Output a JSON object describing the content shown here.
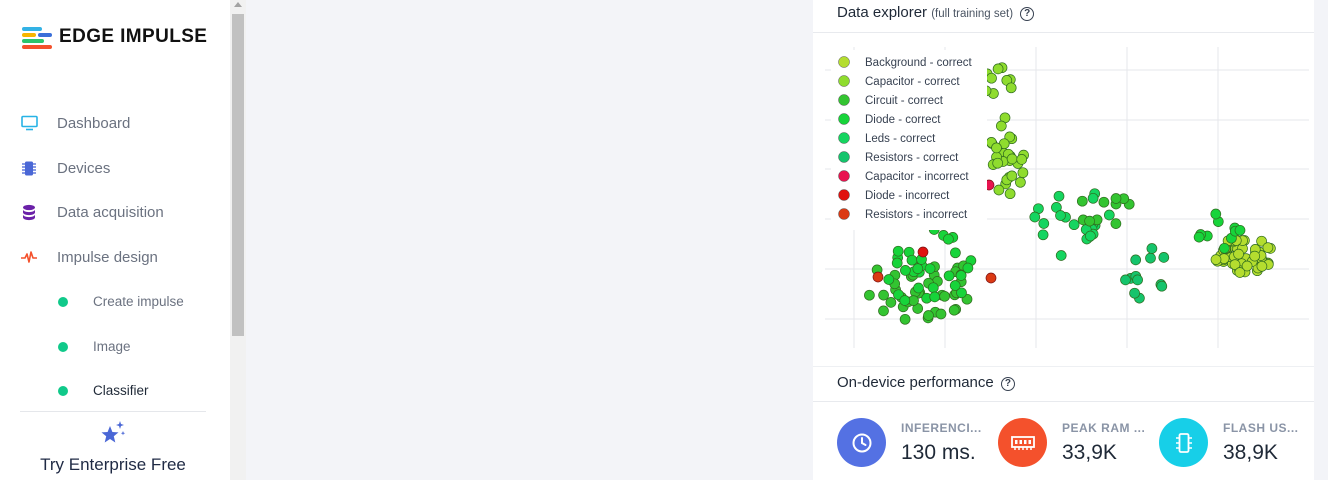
{
  "brand": {
    "name": "EDGE IMPULSE"
  },
  "sidebar": {
    "items": [
      {
        "label": "Dashboard",
        "icon": "monitor-icon"
      },
      {
        "label": "Devices",
        "icon": "chip-icon"
      },
      {
        "label": "Data acquisition",
        "icon": "database-icon"
      },
      {
        "label": "Impulse design",
        "icon": "pulse-icon"
      }
    ],
    "subitems": [
      {
        "label": "Create impulse"
      },
      {
        "label": "Image"
      },
      {
        "label": "Classifier"
      }
    ],
    "enterprise": {
      "label": "Try Enterprise Free",
      "icon": "sparkle-stars-icon"
    }
  },
  "explorer": {
    "title": "Data explorer",
    "subtitle": "(full training set)",
    "help": "?"
  },
  "chart_data": {
    "type": "scatter",
    "title": "",
    "xlabel": "",
    "ylabel": "",
    "grid": true,
    "legend_position": "top-left",
    "series": [
      {
        "name": "Background - correct",
        "color": "#b4dd2f"
      },
      {
        "name": "Capacitor - correct",
        "color": "#8fdc2e"
      },
      {
        "name": "Circuit - correct",
        "color": "#33c431"
      },
      {
        "name": "Diode - correct",
        "color": "#17d43a"
      },
      {
        "name": "Leds - correct",
        "color": "#15d560"
      },
      {
        "name": "Resistors - correct",
        "color": "#15c46c"
      },
      {
        "name": "Capacitor - incorrect",
        "color": "#e8134f"
      },
      {
        "name": "Diode - incorrect",
        "color": "#e0120f"
      },
      {
        "name": "Resistors - incorrect",
        "color": "#db3a14"
      }
    ]
  },
  "performance": {
    "title": "On-device performance",
    "help": "?",
    "metrics": [
      {
        "label": "INFERENCI...",
        "value": "130 ms.",
        "icon": "clock-icon",
        "color": "#5471e3"
      },
      {
        "label": "PEAK RAM ...",
        "value": "33,9K",
        "icon": "ram-icon",
        "color": "#f4512c"
      },
      {
        "label": "FLASH US...",
        "value": "38,9K",
        "icon": "chip-icon",
        "color": "#17cfe8"
      }
    ]
  }
}
